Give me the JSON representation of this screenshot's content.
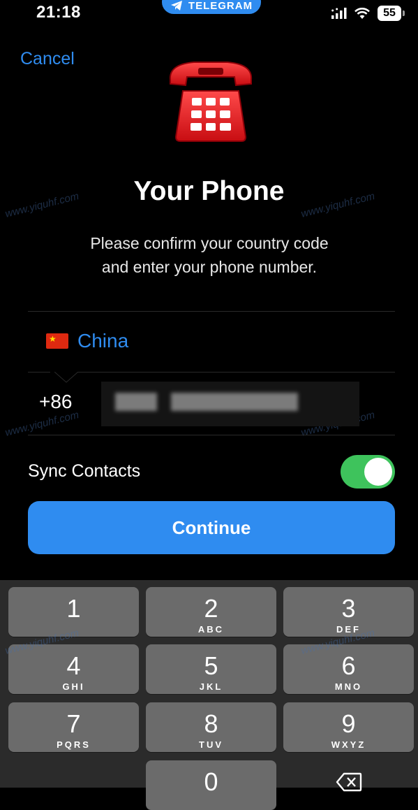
{
  "status_bar": {
    "time": "21:18",
    "app_pill": "TELEGRAM",
    "battery": "55"
  },
  "header": {
    "cancel_label": "Cancel"
  },
  "main": {
    "title": "Your Phone",
    "subtitle_line1": "Please confirm your country code",
    "subtitle_line2": "and enter your phone number.",
    "country": "China",
    "country_code": "+86",
    "sync_label": "Sync Contacts",
    "sync_enabled": true,
    "continue_label": "Continue"
  },
  "watermark": "www.yiquhf.com",
  "keypad": [
    {
      "num": "1",
      "letters": ""
    },
    {
      "num": "2",
      "letters": "ABC"
    },
    {
      "num": "3",
      "letters": "DEF"
    },
    {
      "num": "4",
      "letters": "GHI"
    },
    {
      "num": "5",
      "letters": "JKL"
    },
    {
      "num": "6",
      "letters": "MNO"
    },
    {
      "num": "7",
      "letters": "PQRS"
    },
    {
      "num": "8",
      "letters": "TUV"
    },
    {
      "num": "9",
      "letters": "WXYZ"
    },
    {
      "num": "0",
      "letters": ""
    }
  ],
  "colors": {
    "accent": "#2f8cf0",
    "toggle_on": "#3ec35c",
    "background": "#000000",
    "key": "#6b6b6b"
  },
  "icons": [
    "telegram-plane-icon",
    "signal-icon",
    "wifi-icon",
    "battery-icon",
    "telephone-icon",
    "china-flag-icon",
    "backspace-icon"
  ]
}
